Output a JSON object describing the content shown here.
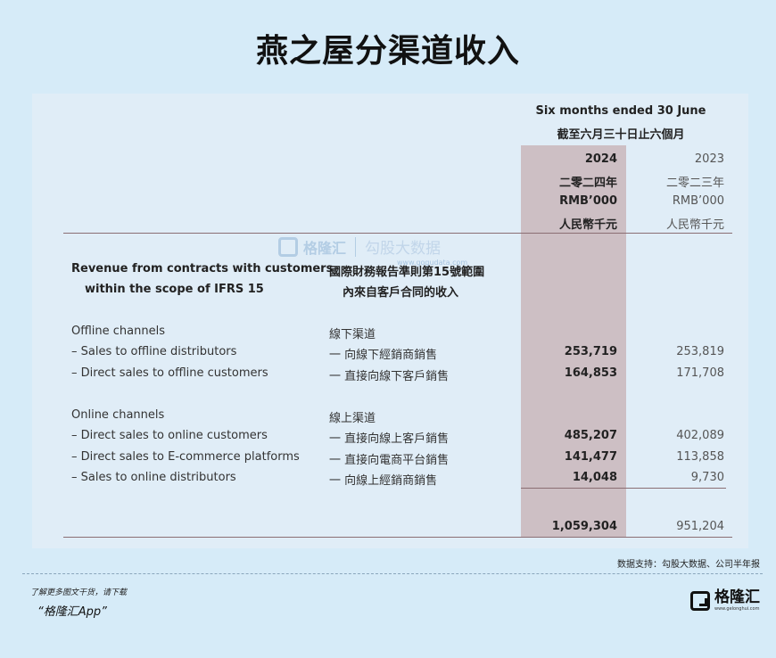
{
  "title": "燕之屋分渠道收入",
  "header": {
    "period_en": "Six months ended 30 June",
    "period_zh": "截至六月三十日止六個月",
    "col2024": {
      "year": "2024",
      "year_zh": "二零二四年",
      "unit": "RMB’000",
      "unit_zh": "人民幣千元"
    },
    "col2023": {
      "year": "2023",
      "year_zh": "二零二三年",
      "unit": "RMB’000",
      "unit_zh": "人民幣千元"
    }
  },
  "section": {
    "en_line1": "Revenue from contracts with customers",
    "en_line2": "within the scope of IFRS 15",
    "zh_line1": "國際財務報告準則第15號範圍",
    "zh_line2": "內來自客戶合同的收入"
  },
  "groups": [
    {
      "en": "Offline channels",
      "zh": "線下渠道",
      "rows": [
        {
          "en": "– Sales to offline distributors",
          "zh": "一 向線下經銷商銷售",
          "v2024": "253,719",
          "v2023": "253,819"
        },
        {
          "en": "– Direct sales to offline customers",
          "zh": "一 直接向線下客戶銷售",
          "v2024": "164,853",
          "v2023": "171,708"
        }
      ]
    },
    {
      "en": "Online channels",
      "zh": "線上渠道",
      "rows": [
        {
          "en": "– Direct sales to online customers",
          "zh": "一 直接向線上客戶銷售",
          "v2024": "485,207",
          "v2023": "402,089"
        },
        {
          "en": "– Direct sales to E-commerce platforms",
          "zh": "一 直接向電商平台銷售",
          "v2024": "141,477",
          "v2023": "113,858"
        },
        {
          "en": "– Sales to online distributors",
          "zh": "一 向線上經銷商銷售",
          "v2024": "14,048",
          "v2023": "9,730"
        }
      ]
    }
  ],
  "total": {
    "v2024": "1,059,304",
    "v2023": "951,204"
  },
  "watermark": {
    "logo_text": "格隆汇",
    "brand_text": "勾股大数据",
    "url": "www.gogudata.com"
  },
  "source_note": "数据支持：勾股大数据、公司半年报",
  "footer": {
    "download_text": "了解更多图文干货，请下载",
    "app_name": "“格隆汇App”",
    "brand_name": "格隆汇",
    "brand_url": "www.gelonghui.com"
  }
}
